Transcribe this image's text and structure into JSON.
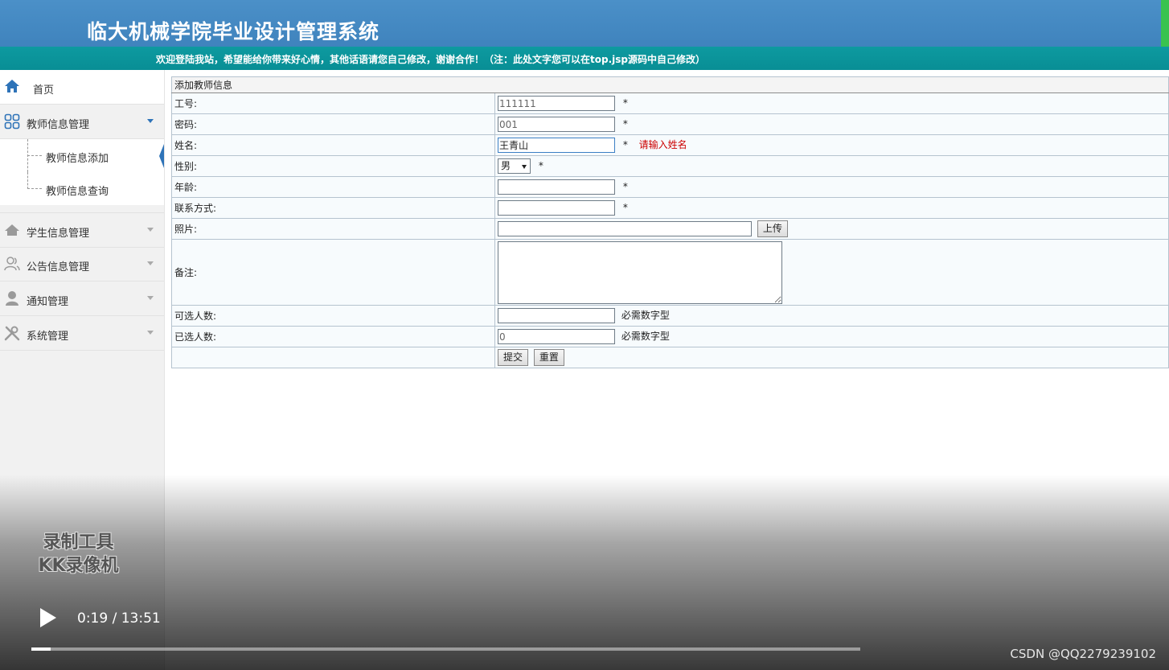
{
  "header": {
    "title": "临大机械学院毕业设计管理系统",
    "welcome": "欢迎登陆我站，希望能给你带来好心情，其他话语请您自己修改，谢谢合作！（注：此处文字您可以在top.jsp源码中自己修改）"
  },
  "sidebar": {
    "home": "首页",
    "teacher": "教师信息管理",
    "teacher_sub": [
      "教师信息添加",
      "教师信息查询"
    ],
    "student": "学生信息管理",
    "notice": "公告信息管理",
    "notify": "通知管理",
    "system": "系统管理"
  },
  "form": {
    "caption": "添加教师信息",
    "fields": {
      "id": {
        "label": "工号:",
        "value": "111111"
      },
      "password": {
        "label": "密码:",
        "value": "001"
      },
      "name": {
        "label": "姓名:",
        "value": "王青山",
        "error": "请输入姓名"
      },
      "gender": {
        "label": "性别:",
        "value": "男"
      },
      "age": {
        "label": "年龄:",
        "value": ""
      },
      "contact": {
        "label": "联系方式:",
        "value": ""
      },
      "photo": {
        "label": "照片:",
        "value": "",
        "button": "上传"
      },
      "remark": {
        "label": "备注:",
        "value": ""
      },
      "max_select": {
        "label": "可选人数:",
        "value": "",
        "hint": "必需数字型"
      },
      "selected": {
        "label": "已选人数:",
        "value": "0",
        "hint": "必需数字型"
      }
    },
    "required_mark": "*",
    "submit": "提交",
    "reset": "重置"
  },
  "video": {
    "time": "0:19 / 13:51",
    "progress": 0.023,
    "watermark_line1": "录制工具",
    "watermark_line2": "KK录像机",
    "credit": "CSDN @QQ2279239102"
  },
  "colors": {
    "header_blue": "#4b90c8",
    "welcome_teal": "#0a949a",
    "accent_blue": "#2e73b8",
    "error_red": "#cc0000"
  }
}
